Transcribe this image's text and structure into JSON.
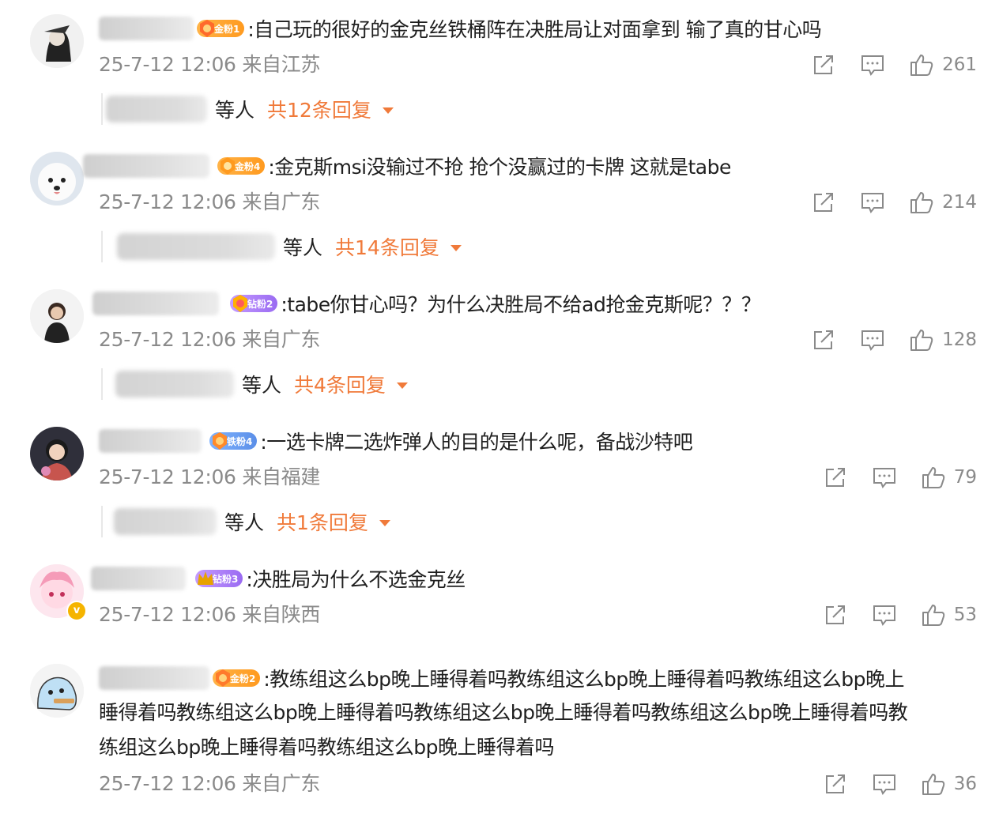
{
  "comments": [
    {
      "badge": "金粉1",
      "text": ":自己玩的很好的金克丝铁桶阵在决胜局让对面拿到 输了真的甘心吗",
      "time": "25-7-12 12:06",
      "location": "来自江苏",
      "likes": "261",
      "reply_suffix": "等人",
      "reply_total": "共12条回复"
    },
    {
      "badge": "金粉4",
      "text": ":金克斯msi没输过不抢 抢个没赢过的卡牌 这就是tabe",
      "time": "25-7-12 12:06",
      "location": "来自广东",
      "likes": "214",
      "reply_suffix": "等人",
      "reply_total": "共14条回复"
    },
    {
      "badge": "钻粉2",
      "text": ":tabe你甘心吗？为什么决胜局不给ad抢金克斯呢？？？",
      "time": "25-7-12 12:06",
      "location": "来自广东",
      "likes": "128",
      "reply_suffix": "等人",
      "reply_total": "共4条回复"
    },
    {
      "badge": "铁粉4",
      "text": ":一选卡牌二选炸弹人的目的是什么呢，备战沙特吧",
      "time": "25-7-12 12:06",
      "location": "来自福建",
      "likes": "79",
      "reply_suffix": "等人",
      "reply_total": "共1条回复"
    },
    {
      "badge": "钻粉3",
      "text": ":决胜局为什么不选金克丝",
      "time": "25-7-12 12:06",
      "location": "来自陕西",
      "likes": "53"
    },
    {
      "badge": "金粉2",
      "text_lines": [
        ":教练组这么bp晚上睡得着吗教练组这么bp晚上睡得着吗教练组这么bp晚上",
        "睡得着吗教练组这么bp晚上睡得着吗教练组这么bp晚上睡得着吗教练组这么bp晚上睡得着吗教",
        "练组这么bp晚上睡得着吗教练组这么bp晚上睡得着吗"
      ],
      "time": "25-7-12 12:06",
      "location": "来自广东",
      "likes": "36"
    }
  ],
  "icons": {
    "share": "share-icon",
    "comment": "comment-icon",
    "like": "thumbs-up-icon",
    "caret": "caret-down-icon"
  },
  "colors": {
    "reply_accent": "#f07a3a",
    "meta_gray": "#8a8a8a"
  }
}
